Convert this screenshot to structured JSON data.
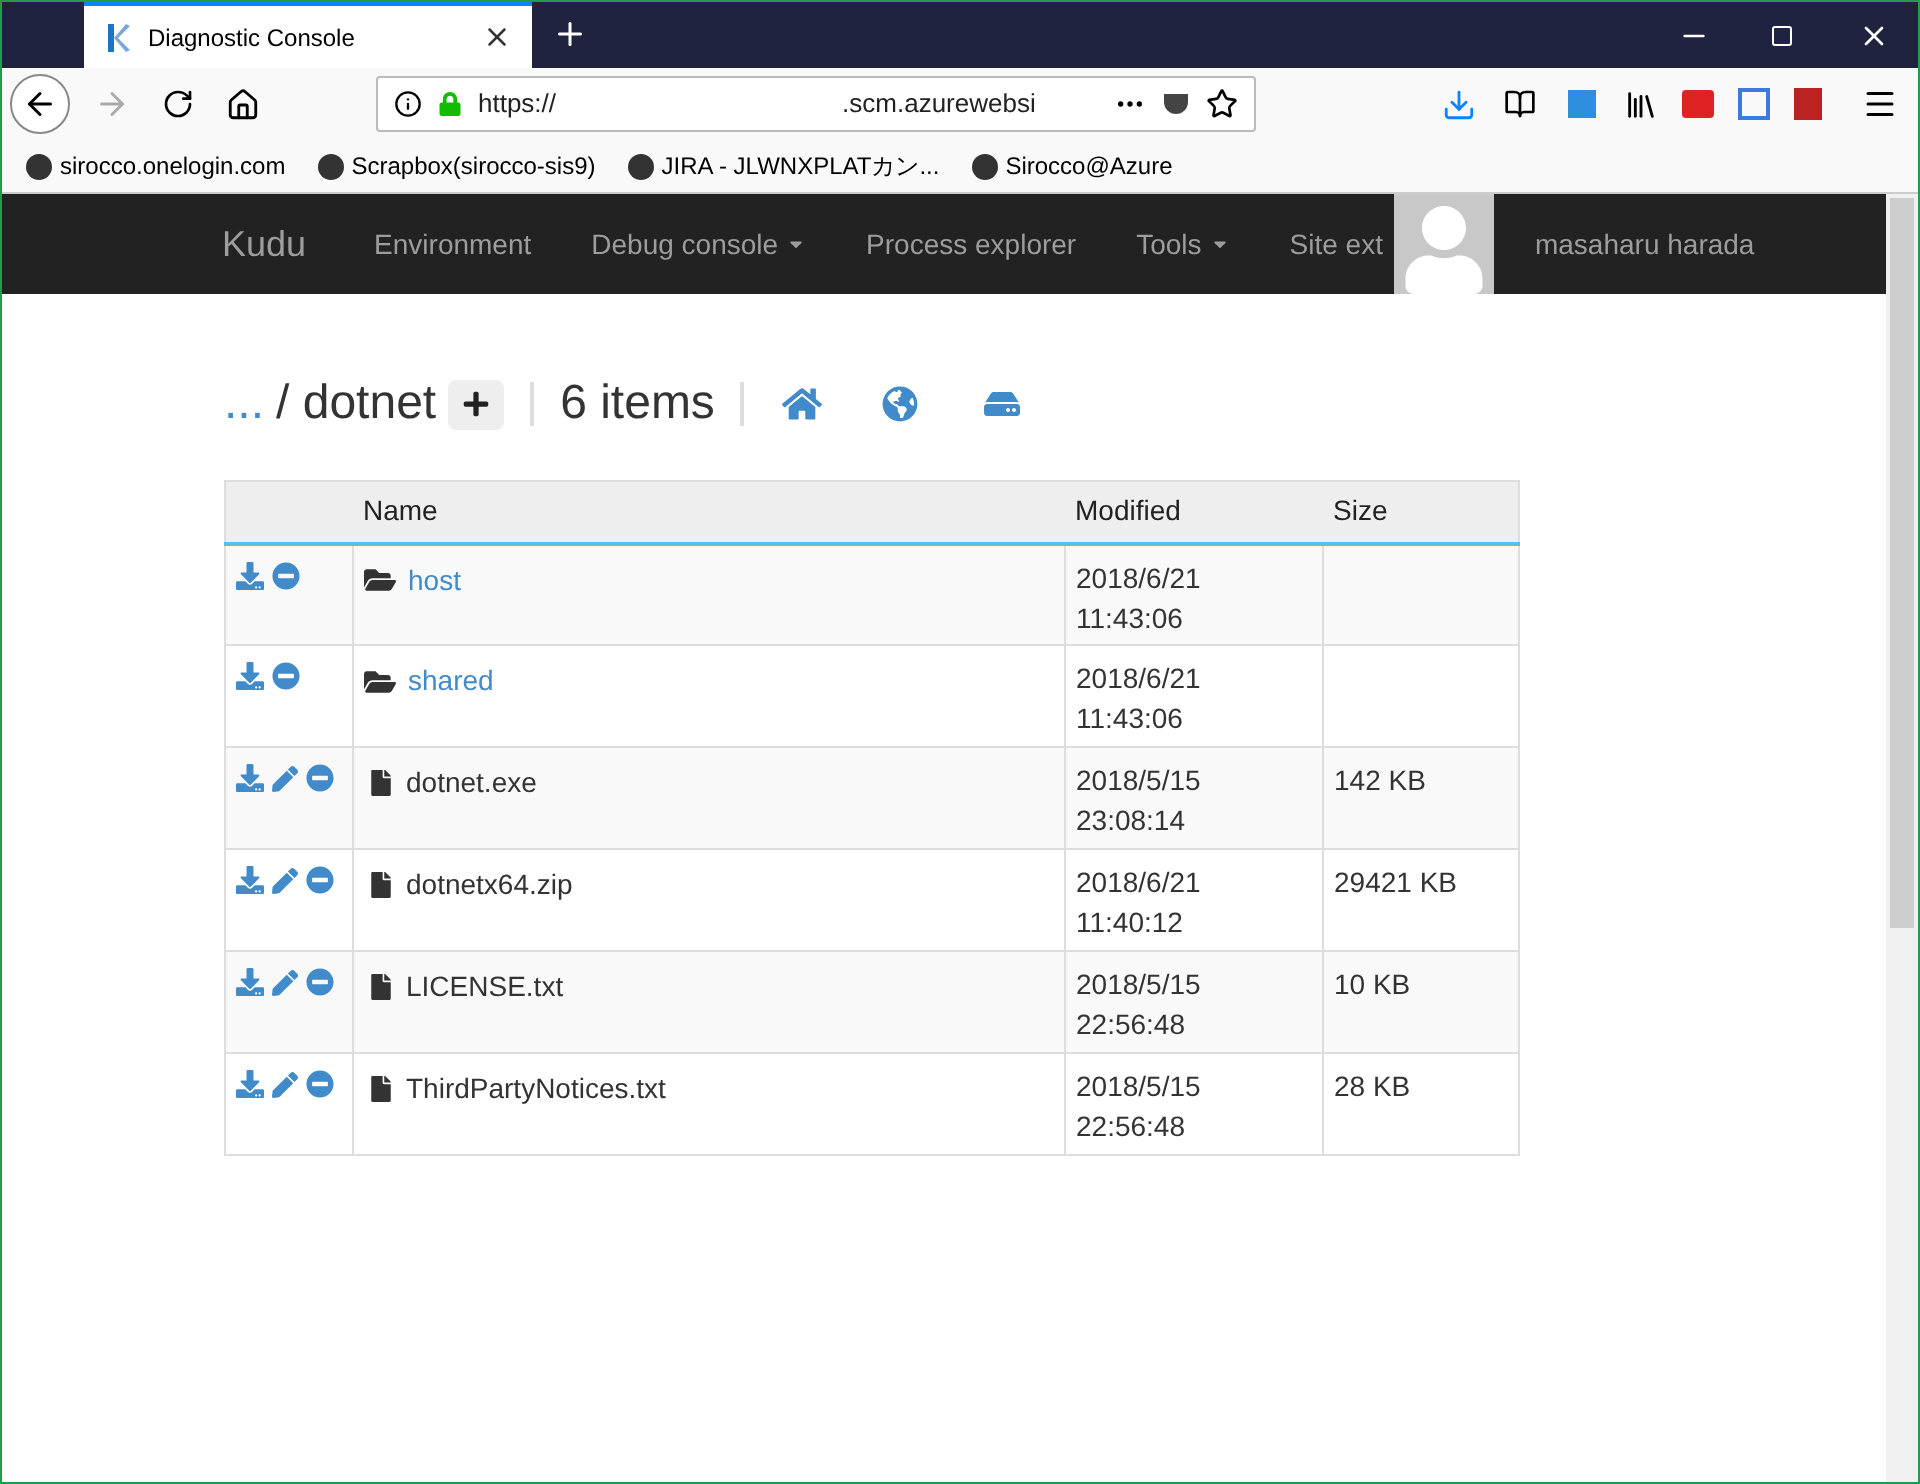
{
  "browser": {
    "tab_title": "Diagnostic Console",
    "url_start": "https://",
    "url_end": ".scm.azurewebsi",
    "bookmarks": [
      {
        "label": "sirocco.onelogin.com"
      },
      {
        "label": "Scrapbox(sirocco-sis9)"
      },
      {
        "label": "JIRA - JLWNXPLATカン..."
      },
      {
        "label": "Sirocco@Azure"
      }
    ]
  },
  "navbar": {
    "logo": "Kudu",
    "items": [
      {
        "label": "Environment",
        "dropdown": false
      },
      {
        "label": "Debug console",
        "dropdown": true
      },
      {
        "label": "Process explorer",
        "dropdown": false
      },
      {
        "label": "Tools",
        "dropdown": true
      },
      {
        "label": "Site ext",
        "dropdown": false
      }
    ],
    "user": "masaharu harada"
  },
  "breadcrumb": {
    "up": "...",
    "folder": "/ dotnet",
    "count": "6 items"
  },
  "table": {
    "columns": [
      "Name",
      "Modified",
      "Size"
    ],
    "rows": [
      {
        "kind": "folder",
        "name": "host",
        "date": "2018/6/21",
        "time": "11:43:06"
      },
      {
        "kind": "folder",
        "name": "shared",
        "date": "2018/6/21",
        "time": "11:43:06"
      },
      {
        "kind": "file",
        "name": "dotnet.exe",
        "date": "2018/5/15",
        "time": "23:08:14",
        "size": "142 KB"
      },
      {
        "kind": "file",
        "name": "dotnetx64.zip",
        "date": "2018/6/21",
        "time": "11:40:12",
        "size": "29421 KB"
      },
      {
        "kind": "file",
        "name": "LICENSE.txt",
        "date": "2018/5/15",
        "time": "22:56:48",
        "size": "10 KB"
      },
      {
        "kind": "file",
        "name": "ThirdPartyNotices.txt",
        "date": "2018/5/15",
        "time": "22:56:48",
        "size": "28 KB"
      }
    ]
  }
}
